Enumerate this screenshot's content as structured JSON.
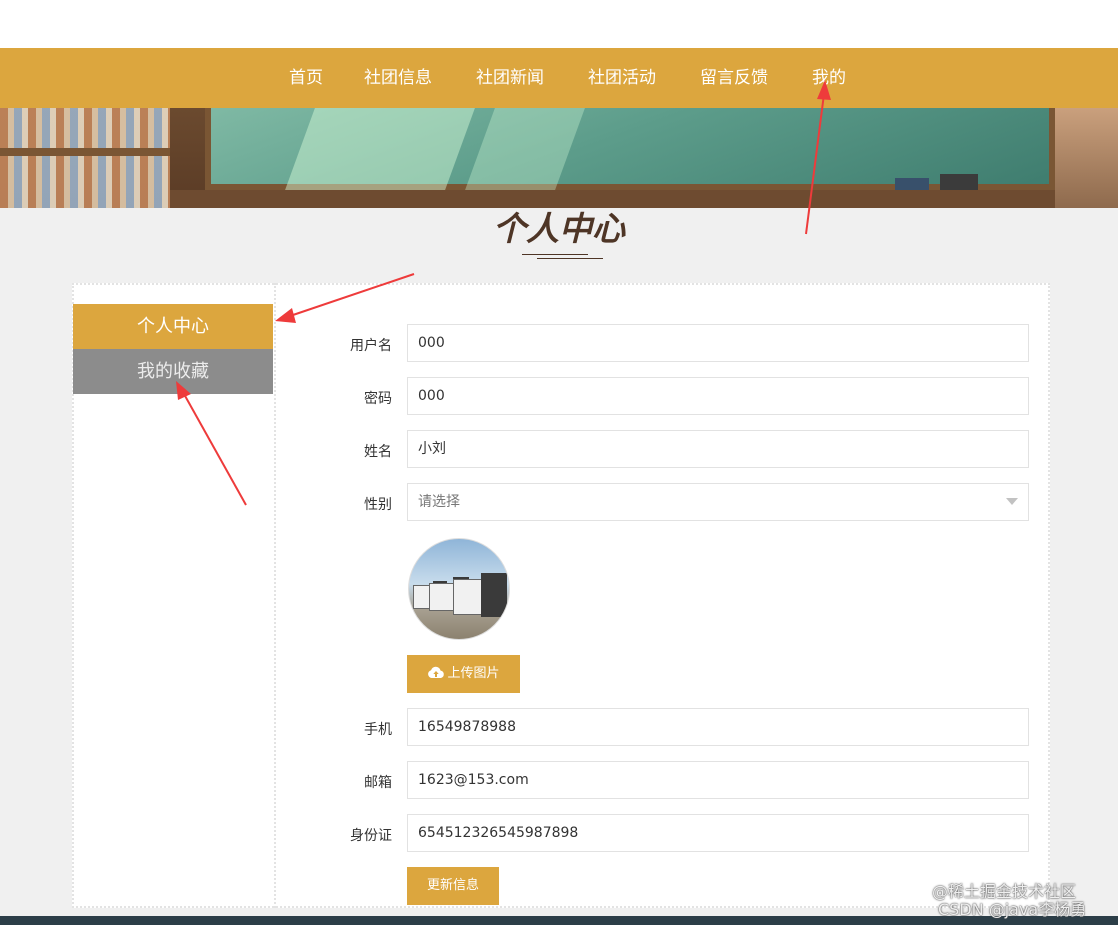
{
  "nav": {
    "items": [
      "首页",
      "社团信息",
      "社团新闻",
      "社团活动",
      "留言反馈",
      "我的"
    ]
  },
  "page": {
    "title": "个人中心"
  },
  "sidebar": {
    "items": [
      {
        "label": "个人中心",
        "active": true
      },
      {
        "label": "我的收藏",
        "active": false
      }
    ]
  },
  "form": {
    "username": {
      "label": "用户名",
      "value": "000"
    },
    "password": {
      "label": "密码",
      "value": "000"
    },
    "name": {
      "label": "姓名",
      "value": "小刘"
    },
    "gender": {
      "label": "性别",
      "placeholder": "请选择"
    },
    "upload_label": "上传图片",
    "phone": {
      "label": "手机",
      "value": "16549878988"
    },
    "email": {
      "label": "邮箱",
      "value": "1623@153.com"
    },
    "idcard": {
      "label": "身份证",
      "value": "654512326545987898"
    },
    "submit_label": "更新信息"
  },
  "watermark": {
    "line1": "@稀土掘金技术社区",
    "line2": "CSDN @java李杨勇"
  },
  "colors": {
    "accent": "#dca63e",
    "sidebar_inactive": "#8c8c8c",
    "title": "#4e3526",
    "annotation_arrow": "#ee3b3b"
  }
}
